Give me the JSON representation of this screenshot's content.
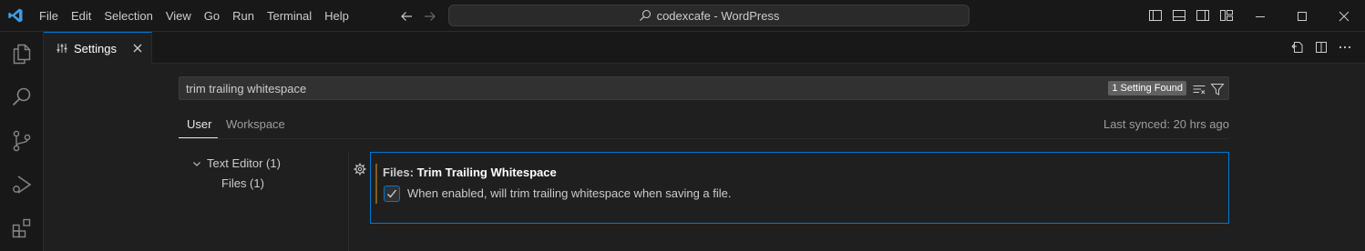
{
  "menu": {
    "items": [
      "File",
      "Edit",
      "Selection",
      "View",
      "Go",
      "Run",
      "Terminal",
      "Help"
    ]
  },
  "command_center": {
    "text": "codexcafe - WordPress"
  },
  "tab": {
    "label": "Settings"
  },
  "search": {
    "value": "trim trailing whitespace",
    "result_count": "1 Setting Found"
  },
  "scopes": {
    "user": "User",
    "workspace": "Workspace"
  },
  "sync_status": "Last synced: 20 hrs ago",
  "toc": {
    "group": "Text Editor (1)",
    "child": "Files (1)"
  },
  "setting": {
    "category": "Files: ",
    "name": "Trim Trailing Whitespace",
    "description": "When enabled, will trim trailing whitespace when saving a file.",
    "checked": true
  },
  "colors": {
    "accent": "#0078d4",
    "modified_bar": "#805e1c",
    "background": "#1f1f1f",
    "chrome": "#181818"
  },
  "icons": {
    "activity": [
      "explorer-icon",
      "search-icon",
      "source-control-icon",
      "run-debug-icon",
      "extensions-icon"
    ]
  }
}
